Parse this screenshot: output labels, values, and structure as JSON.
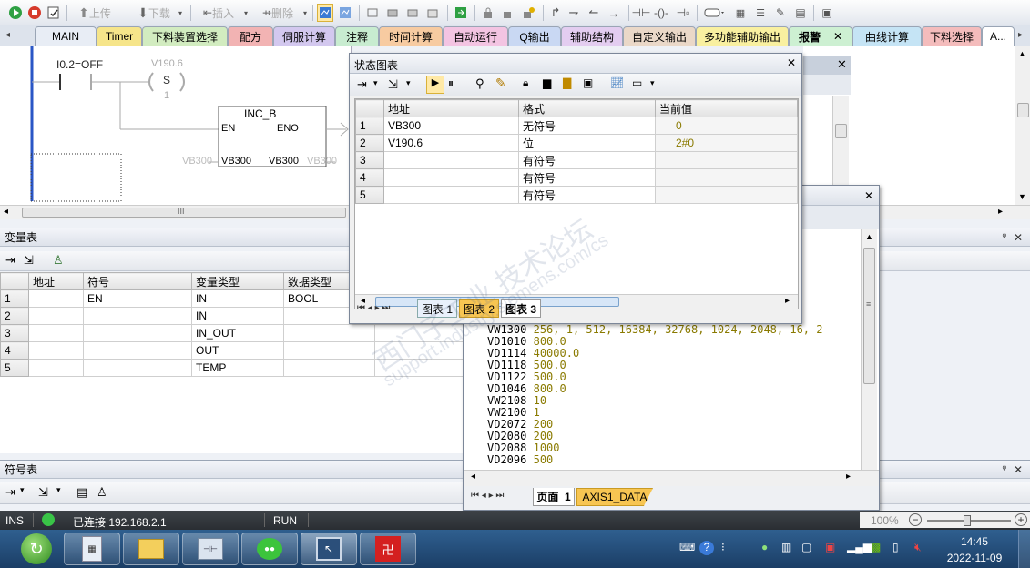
{
  "colors": {
    "toolbar_bg": "#e3e7ee",
    "taskbar_bg": "#1b3e66",
    "accent_blue": "#2a56c6",
    "value_olive": "#8a7a00",
    "active_tab": "#fff3a8"
  },
  "toolbar": {
    "upload_label": "上传",
    "download_label": "下载",
    "insert_label": "插入",
    "delete_label": "删除",
    "icons": [
      "run-icon",
      "stop-icon",
      "compile-icon",
      "upload-icon",
      "download-icon",
      "insert-icon",
      "delete-icon",
      "monitor-icon",
      "monitor-table-icon",
      "stop-monitor-icon",
      "pause-icon",
      "lock-icon",
      "force-icon",
      "contact-no-icon",
      "coil-icon",
      "box-icon"
    ]
  },
  "tabs": [
    {
      "label": "MAIN",
      "color": "#e8edf5"
    },
    {
      "label": "Timer",
      "color": "#f6e58a"
    },
    {
      "label": "下料装置选择",
      "color": "#d2ecc0"
    },
    {
      "label": "配方",
      "color": "#f2b3b3"
    },
    {
      "label": "伺服计算",
      "color": "#d3c8ef"
    },
    {
      "label": "注释",
      "color": "#c8ecd0"
    },
    {
      "label": "时间计算",
      "color": "#f7cba1"
    },
    {
      "label": "自动运行",
      "color": "#f3c4e2"
    },
    {
      "label": "Q输出",
      "color": "#c9d8f3"
    },
    {
      "label": "辅助结构",
      "color": "#e3cdf0"
    },
    {
      "label": "自定义输出",
      "color": "#ead8c8"
    },
    {
      "label": "多功能辅助输出",
      "color": "#f9f0a0"
    },
    {
      "label": "报警",
      "color": "#cdf0d2"
    },
    {
      "label": "曲线计算",
      "color": "#c5e4f5"
    },
    {
      "label": "下料选择",
      "color": "#f4bcbc"
    },
    {
      "label": "A...",
      "color": "#ffffff"
    }
  ],
  "ladder": {
    "contact_label": "I0.2=OFF",
    "coil_addr": "V190.6",
    "coil_type": "S",
    "coil_count": "1",
    "box_title": "INC_B",
    "box_en": "EN",
    "box_eno": "ENO",
    "box_in": "VB300",
    "box_out": "VB300",
    "box_in_ext": "VB300",
    "box_out_ext": "VB300",
    "scroll_mark": "III"
  },
  "status_chart": {
    "title": "状态图表",
    "close": "✕",
    "columns": [
      "地址",
      "格式",
      "当前值"
    ],
    "rows": [
      {
        "n": "1",
        "addr": "VB300",
        "fmt": "无符号",
        "val": "0"
      },
      {
        "n": "2",
        "addr": "V190.6",
        "fmt": "位",
        "val": "2#0"
      },
      {
        "n": "3",
        "addr": "",
        "fmt": "有符号",
        "val": ""
      },
      {
        "n": "4",
        "addr": "",
        "fmt": "有符号",
        "val": ""
      },
      {
        "n": "5",
        "addr": "",
        "fmt": "有符号",
        "val": ""
      }
    ],
    "sheet_tabs": [
      "图表 1",
      "图表 2",
      "图表 3"
    ]
  },
  "var_table": {
    "title": "变量表",
    "pin": "ᵠ",
    "close": "✕",
    "columns": [
      "地址",
      "符号",
      "变量类型",
      "数据类型"
    ],
    "rows": [
      {
        "n": "1",
        "addr": "",
        "sym": "EN",
        "vtype": "IN",
        "dtype": "BOOL"
      },
      {
        "n": "2",
        "addr": "",
        "sym": "",
        "vtype": "IN",
        "dtype": ""
      },
      {
        "n": "3",
        "addr": "",
        "sym": "",
        "vtype": "IN_OUT",
        "dtype": ""
      },
      {
        "n": "4",
        "addr": "",
        "sym": "",
        "vtype": "OUT",
        "dtype": ""
      },
      {
        "n": "5",
        "addr": "",
        "sym": "",
        "vtype": "TEMP",
        "dtype": ""
      }
    ]
  },
  "symbol_table": {
    "title": "符号表",
    "pin": "ᵠ",
    "close": "✕"
  },
  "data_block": {
    "close": "✕",
    "lines": [
      {
        "addr": "VW1300",
        "val": "256, 1, 512, 16384, 32768, 1024, 2048, 16, 2"
      },
      {
        "addr": "VD1010",
        "val": "800.0"
      },
      {
        "addr": "VD1114",
        "val": "40000.0"
      },
      {
        "addr": "VD1118",
        "val": "500.0"
      },
      {
        "addr": "VD1122",
        "val": "500.0"
      },
      {
        "addr": "VD1046",
        "val": "800.0"
      },
      {
        "addr": "VW2108",
        "val": "10"
      },
      {
        "addr": "VW2100",
        "val": "1"
      },
      {
        "addr": "VD2072",
        "val": "200"
      },
      {
        "addr": "VD2080",
        "val": "200"
      },
      {
        "addr": "VD2088",
        "val": "1000"
      },
      {
        "addr": "VD2096",
        "val": "500"
      }
    ],
    "page_tabs": [
      "页面_1",
      "AXIS1_DATA"
    ]
  },
  "statusbar": {
    "mode": "INS",
    "connection": "已连接 192.168.2.1",
    "run_state": "RUN",
    "zoom": "100%"
  },
  "taskbar": {
    "apps": [
      "start-icon",
      "calculator-icon",
      "explorer-icon",
      "plc-app-icon",
      "wechat-icon",
      "remote-icon",
      "red-app-icon"
    ],
    "time": "14:45",
    "date": "2022-11-09"
  },
  "watermark": {
    "line1": "西门子工业 技术论坛",
    "line2": "support.industry.siemens.com/cs"
  }
}
